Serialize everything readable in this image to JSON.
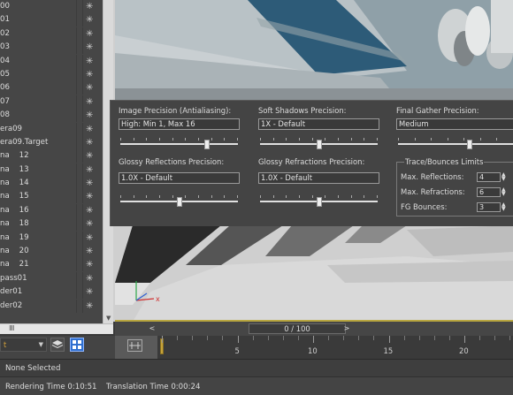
{
  "scene_list": {
    "items": [
      "00",
      "01",
      "02",
      "03",
      "04",
      "05",
      "06",
      "07",
      "08",
      "era09",
      "era09.Target",
      "na    12",
      "na    13",
      "na    14",
      "na    15",
      "na    16",
      "na    18",
      "na    19",
      "na    20",
      "na    21",
      "pass01",
      "der01",
      "der02"
    ],
    "hscroll_thumb": "IIII"
  },
  "render_panel": {
    "image_precision": {
      "label": "Image Precision (Antialiasing):",
      "value": "High: Min 1, Max 16"
    },
    "soft_shadows": {
      "label": "Soft Shadows Precision:",
      "value": "1X - Default"
    },
    "final_gather": {
      "label": "Final Gather Precision:",
      "value": "Medium"
    },
    "glossy_reflections": {
      "label": "Glossy Reflections Precision:",
      "value": "1.0X - Default"
    },
    "glossy_refractions": {
      "label": "Glossy Refractions Precision:",
      "value": "1.0X - Default"
    },
    "trace_limits": {
      "title": "Trace/Bounces Limits",
      "max_reflections": {
        "label": "Max. Reflections:",
        "value": "4"
      },
      "max_refractions": {
        "label": "Max. Refractions:",
        "value": "6"
      },
      "fg_bounces": {
        "label": "FG Bounces:",
        "value": "3"
      }
    }
  },
  "timeline": {
    "frame_display": "0 / 100",
    "prev": "<",
    "next": ">",
    "ruler_numbers": [
      "5",
      "10",
      "15",
      "20"
    ]
  },
  "bottom_tools": {
    "dropdown_text": "t"
  },
  "status": {
    "selection": "None Selected",
    "rendering_time": "Rendering Time  0:10:51",
    "translation_time": "Translation Time  0:00:24"
  },
  "colors": {
    "accent_playhead": "#c7a43a",
    "viewport_border": "#b8a640"
  }
}
